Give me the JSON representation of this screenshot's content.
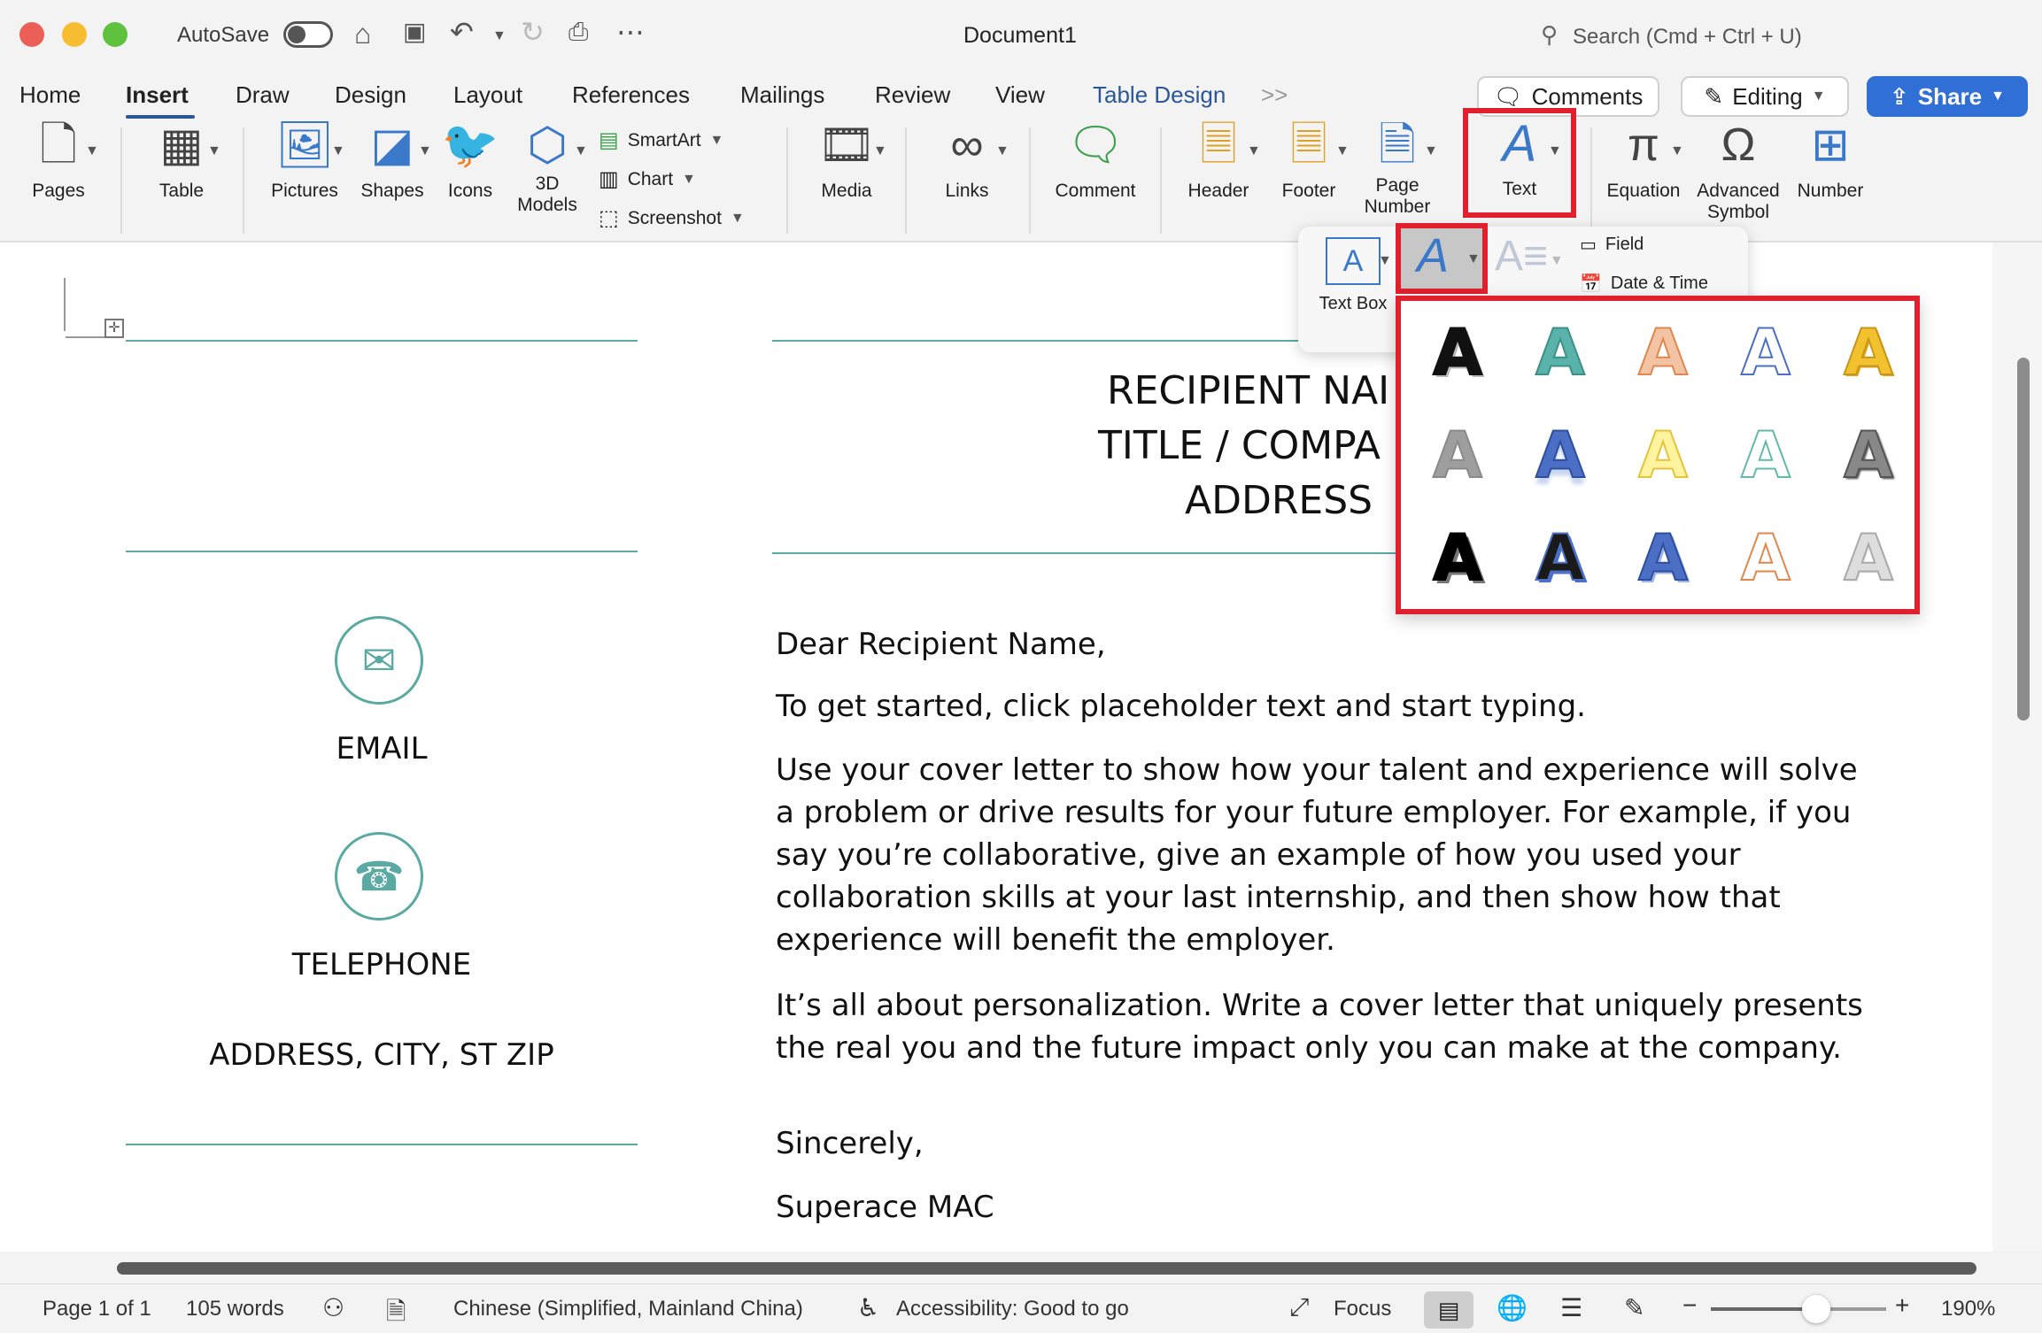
{
  "titlebar": {
    "autosave_label": "AutoSave",
    "doc_title": "Document1",
    "search_placeholder": "Search (Cmd + Ctrl + U)"
  },
  "tabs": [
    "Home",
    "Insert",
    "Draw",
    "Design",
    "Layout",
    "References",
    "Mailings",
    "Review",
    "View",
    "Table Design"
  ],
  "active_tab": "Insert",
  "tab_overflow": ">>",
  "header_buttons": {
    "comments": "Comments",
    "editing": "Editing",
    "share": "Share"
  },
  "ribbon": {
    "pages": "Pages",
    "table": "Table",
    "pictures": "Pictures",
    "shapes": "Shapes",
    "icons": "Icons",
    "models_line1": "3D",
    "models_line2": "Models",
    "smartart": "SmartArt",
    "chart": "Chart",
    "screenshot": "Screenshot",
    "media": "Media",
    "links": "Links",
    "comment": "Comment",
    "header": "Header",
    "footer": "Footer",
    "page_number_line1": "Page",
    "page_number_line2": "Number",
    "text": "Text",
    "equation": "Equation",
    "advanced_symbol_line1": "Advanced",
    "advanced_symbol_line2": "Symbol",
    "number": "Number"
  },
  "text_panel": {
    "text_box": "Text Box",
    "field": "Field",
    "date_time": "Date & Time"
  },
  "wordart_styles": [
    {
      "fill": "#111111",
      "stroke": "#111111",
      "shadow": "3px 3px 0 #bbbbbb"
    },
    {
      "fill": "#5ab3ab",
      "stroke": "#3d8f88",
      "shadow": "none"
    },
    {
      "fill": "#f3c4a4",
      "stroke": "#e0874e",
      "shadow": "none"
    },
    {
      "fill": "#ffffff",
      "stroke": "#4a6fc4",
      "shadow": "none"
    },
    {
      "fill": "#f2c12e",
      "stroke": "#c9961b",
      "shadow": "2px 2px 0 #e6a417"
    },
    {
      "fill": "#9e9e9e",
      "stroke": "#8a8a8a",
      "shadow": "none"
    },
    {
      "fill": "#4a6fc4",
      "stroke": "#2f4f9e",
      "shadow": "0 8px 4px #c9d6f1"
    },
    {
      "fill": "#fff3a0",
      "stroke": "#e3c53a",
      "shadow": "none"
    },
    {
      "fill": "#ffffff",
      "stroke": "#66b8ae",
      "shadow": "none"
    },
    {
      "fill": "#888888",
      "stroke": "#555555",
      "shadow": "2px 2px 2px #444444"
    },
    {
      "fill": "#000000",
      "stroke": "#000000",
      "shadow": "4px 4px 0 #777777"
    },
    {
      "fill": "#1a1a1a",
      "stroke": "#4a6fc4",
      "shadow": "3px 3px 0 #4a6fc4"
    },
    {
      "fill": "#4a6fc4",
      "stroke": "#2f4f9e",
      "shadow": "3px 3px 0 #9fb3e6"
    },
    {
      "fill": "#ffffff",
      "stroke": "#e0874e",
      "shadow": "none"
    },
    {
      "fill": "#dddddd",
      "stroke": "#aaaaaa",
      "shadow": "2px 2px 0 #eeeeee"
    }
  ],
  "wordart_letter": "A",
  "document": {
    "recipient_name": "RECIPIENT NAI",
    "title_company": "TITLE / COMPA",
    "address": "ADDRESS",
    "email_label": "EMAIL",
    "telephone_label": "TELEPHONE",
    "address_city": "ADDRESS, CITY, ST ZIP",
    "salutation": "Dear Recipient Name,",
    "para1": "To get started, click placeholder text and start typing.",
    "para2_lines": [
      "Use your cover letter to show how your talent and experience will solve",
      "a problem or drive results for your future employer. For example, if you",
      "say you’re collaborative, give an example of how you used your",
      "collaboration skills at your last internship, and then show how that",
      "experience will benefit the employer."
    ],
    "para3_lines": [
      "It’s all about personalization. Write a cover letter that uniquely presents",
      "the real you and the future impact only you can make at the company."
    ],
    "closing": "Sincerely,",
    "signature": "Superace MAC"
  },
  "statusbar": {
    "page": "Page 1 of 1",
    "words": "105 words",
    "language": "Chinese (Simplified, Mainland China)",
    "accessibility": "Accessibility: Good to go",
    "focus": "Focus",
    "zoom": "190%",
    "zoom_level": 0.6
  },
  "colors": {
    "accent": "#2b5797",
    "highlight_red": "#e0202e",
    "teal": "#5aa9a2",
    "share_blue": "#2f6fd6"
  }
}
